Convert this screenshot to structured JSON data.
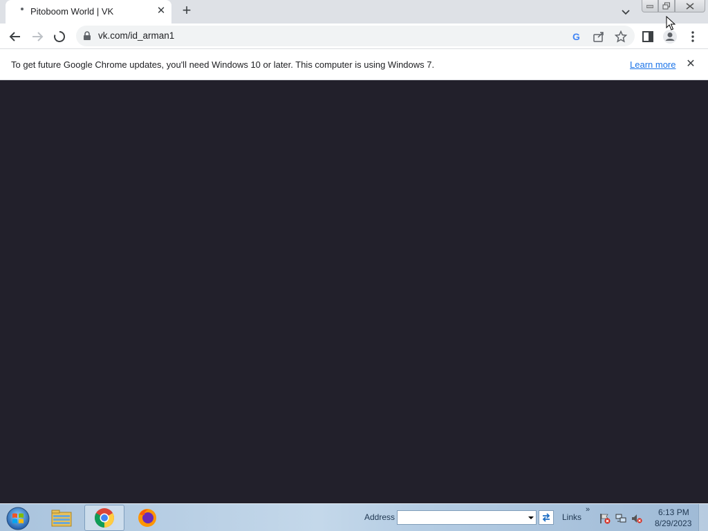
{
  "browser": {
    "tab": {
      "title": "Pitoboom World | VK",
      "close_icon": "close-icon"
    },
    "url": "vk.com/id_arman1",
    "infobar": {
      "message": "To get future Google Chrome updates, you'll need Windows 10 or later. This computer is using Windows 7.",
      "link": "Learn more"
    }
  },
  "taskbar": {
    "apps": [
      "Windows Explorer",
      "Google Chrome",
      "Firefox"
    ],
    "address_label": "Address",
    "address_value": "",
    "links_label": "Links",
    "links_chevron": "»",
    "clock": {
      "time": "6:13 PM",
      "date": "8/29/2023"
    }
  },
  "colors": {
    "page_background": "#22202b",
    "tabstrip": "#dee1e6",
    "link": "#1a73e8"
  }
}
